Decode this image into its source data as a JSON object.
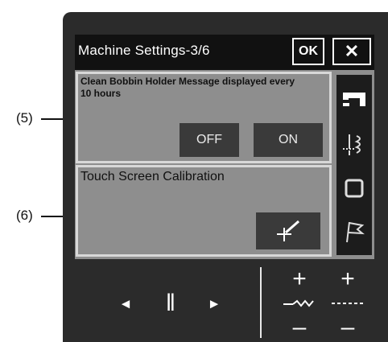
{
  "callouts": {
    "c5": "(5)",
    "c6": "(6)"
  },
  "screen": {
    "title": "Machine Settings-3/6",
    "ok_label": "OK",
    "close_label": "✕"
  },
  "bobbin_setting": {
    "message": "Clean Bobbin Holder Message displayed every 10 hours",
    "off_label": "OFF",
    "on_label": "ON"
  },
  "calibration": {
    "label": "Touch Screen Calibration"
  },
  "tabs": [
    "sewing-machine-icon",
    "embroidery-icon",
    "square-frame-icon",
    "flag-icon"
  ],
  "bottom_controls": {
    "left_arrow": "◄",
    "pause": "‖",
    "right_arrow": "►",
    "plus": "+",
    "minus": "–"
  },
  "colors": {
    "lcd": "#8e8e8e",
    "button": "#3a3a3a",
    "machine": "#2b2b2b"
  }
}
